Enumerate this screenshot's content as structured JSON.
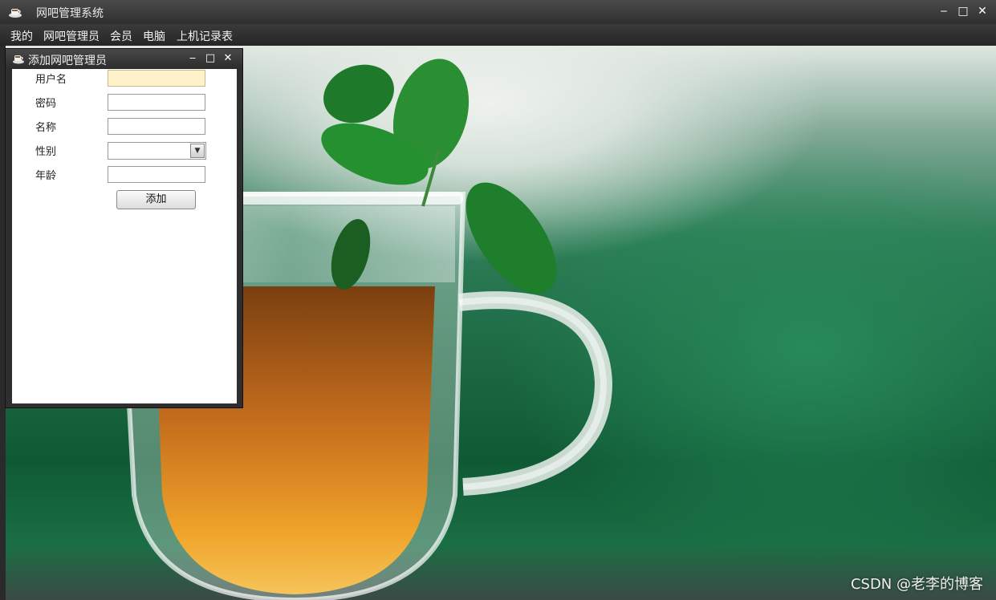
{
  "window": {
    "title": "网吧管理系统",
    "icon": "coffee-cup-icon"
  },
  "menu": [
    "我的",
    "网吧管理员",
    "会员",
    "电脑",
    "上机记录表"
  ],
  "dialog": {
    "title": "添加网吧管理员",
    "icon": "coffee-cup-icon",
    "fields": {
      "username_label": "用户名",
      "password_label": "密码",
      "name_label": "名称",
      "gender_label": "性别",
      "age_label": "年龄",
      "username_value": "",
      "password_value": "",
      "name_value": "",
      "gender_value": "",
      "age_value": ""
    },
    "add_label": "添加"
  },
  "watermark": "CSDN @老李的博客",
  "colors": {
    "focused_field": "#fdf2c9",
    "titlebar": "#3a3a3a"
  }
}
